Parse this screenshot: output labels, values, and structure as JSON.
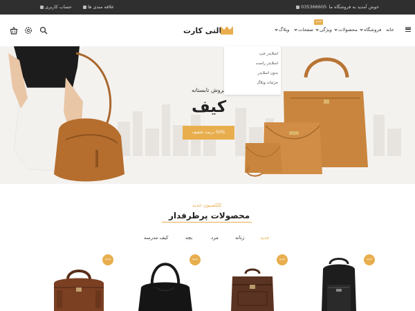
{
  "topbar": {
    "welcome": "خوش آمدید به فروشگاه ما",
    "phone": "035366605",
    "wishlist": "علاقه مندی ها",
    "account": "حساب کاربری"
  },
  "nav": {
    "items": [
      "خانه",
      "فروشگاه",
      "محصولات",
      "ویژگی",
      "صفحات",
      "وبلاگ"
    ],
    "badge": "جدید"
  },
  "logo": {
    "text": "مالتی کارت",
    "accent": "#e8ae4e"
  },
  "dropdown": {
    "items": [
      "اسلایدر چپ",
      "اسلایدر راست",
      "بدون اسلایدر",
      "جزئیات وبلاگ"
    ]
  },
  "hero": {
    "subtitle": "فروش تابستانه",
    "title": "کیف",
    "button": "50% درصد تخفیف"
  },
  "section": {
    "subtitle": "کلکسیون جدید",
    "title": "محصولات پرطرفدار",
    "tabs": [
      "جدید",
      "زنانه",
      "مرد",
      "بچه",
      "کیف مدرسه"
    ]
  },
  "products": {
    "badge": "جدید",
    "items": [
      {
        "icon": "black-backpack-icon"
      },
      {
        "icon": "brown-briefcase-bag-icon"
      },
      {
        "icon": "black-shoulder-bag-icon"
      },
      {
        "icon": "brown-duffel-bag-icon"
      }
    ]
  },
  "colors": {
    "accent": "#e8ae4e",
    "topbar": "#2f2f2f"
  }
}
